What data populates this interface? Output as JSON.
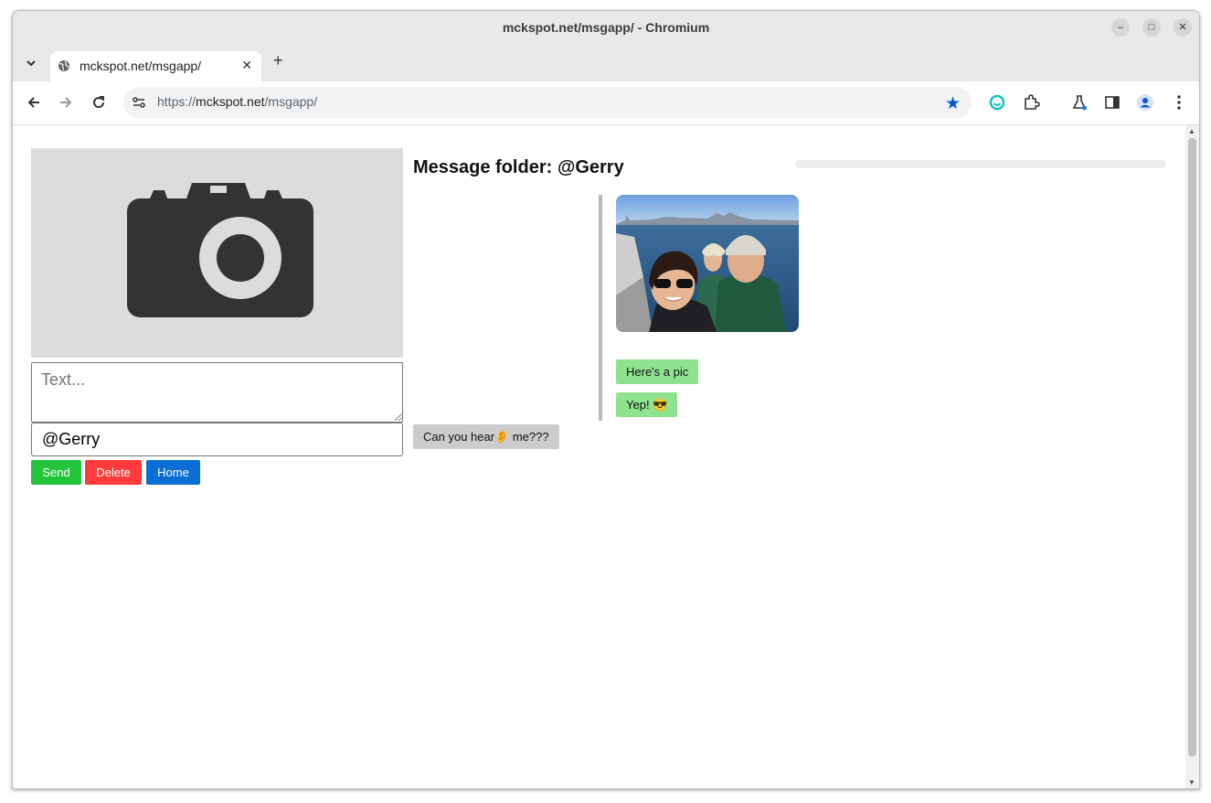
{
  "window": {
    "title": "mckspot.net/msgapp/ - Chromium"
  },
  "tab": {
    "title": "mckspot.net/msgapp/",
    "close": "✕",
    "new_tab": "+"
  },
  "address": {
    "scheme": "https://",
    "host": "mckspot.net",
    "path": "/msgapp/"
  },
  "colors": {
    "send": "#22c43b",
    "delete": "#ff3b3b",
    "home": "#0a6fd4",
    "sent_bubble": "#8fe38f",
    "received_bubble": "#cccccc"
  },
  "composer": {
    "image_placeholder_icon": "camera-icon",
    "text_placeholder": "Text...",
    "recipient_value": "@Gerry",
    "buttons": {
      "send": "Send",
      "delete": "Delete",
      "home": "Home"
    }
  },
  "folder": {
    "title": "Message folder: @Gerry",
    "messages": [
      {
        "text": "Here's a pic",
        "side": "right"
      },
      {
        "text": "Yep! 😎",
        "side": "right"
      },
      {
        "text": "Can you hear👂 me???",
        "side": "left"
      }
    ]
  }
}
